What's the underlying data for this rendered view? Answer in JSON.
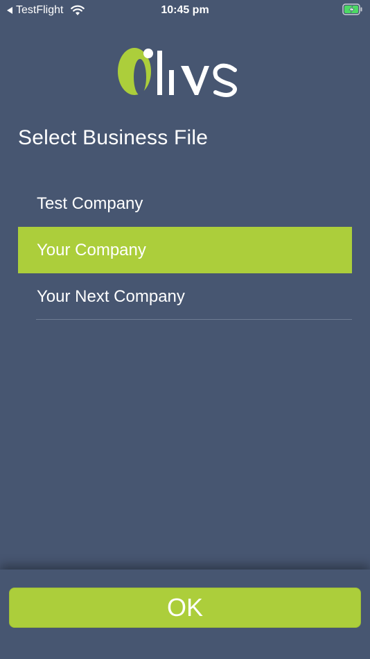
{
  "status_bar": {
    "back_app": "TestFlight",
    "time": "10:45 pm",
    "icons": [
      "back-arrow-icon",
      "wifi-icon",
      "battery-charging-icon"
    ]
  },
  "logo": {
    "text": "Olivs",
    "colors": {
      "accent": "#acce3b",
      "text": "#ffffff"
    }
  },
  "page": {
    "title": "Select Business File"
  },
  "business_files": {
    "items": [
      {
        "label": "Test Company",
        "selected": false
      },
      {
        "label": "Your Company",
        "selected": true
      },
      {
        "label": "Your Next Company",
        "selected": false
      }
    ]
  },
  "actions": {
    "ok_label": "OK"
  },
  "colors": {
    "background": "#475671",
    "accent": "#acce3b",
    "text": "#ffffff"
  }
}
